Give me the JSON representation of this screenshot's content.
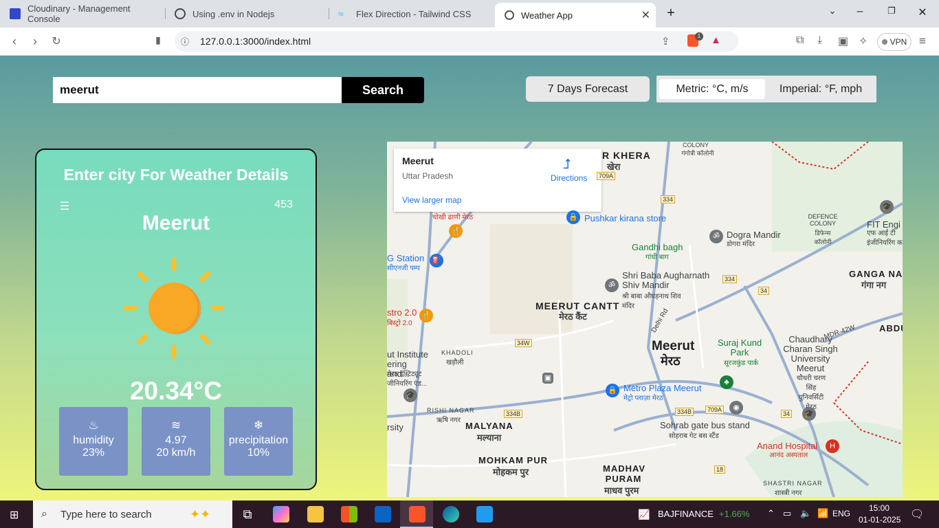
{
  "browser": {
    "tabs": [
      {
        "title": "Cloudinary - Management Console",
        "active": false
      },
      {
        "title": "Using .env in Nodejs",
        "active": false
      },
      {
        "title": "Flex Direction - Tailwind CSS",
        "active": false
      },
      {
        "title": "Weather App",
        "active": true
      }
    ],
    "url": "127.0.0.1:3000/index.html",
    "vpn_label": "VPN",
    "brave_badge": "1"
  },
  "app": {
    "search": {
      "value": "meerut",
      "button": "Search"
    },
    "forecast_button": "7 Days Forecast",
    "units": {
      "metric": "Metric: °C, m/s",
      "imperial": "Imperial: °F, mph",
      "selected": "metric"
    },
    "card": {
      "title": "Enter city For Weather Details",
      "code": "453",
      "city": "Meerut",
      "temperature": "20.34°C",
      "condition_icon": "sun-icon",
      "stats": [
        {
          "icon": "humidity-icon",
          "label": "humidity",
          "value": "23%"
        },
        {
          "icon": "wind-icon",
          "label": "4.97",
          "value": "20 km/h"
        },
        {
          "icon": "snowflake-icon",
          "label": "precipitation",
          "value": "10%"
        }
      ]
    }
  },
  "map": {
    "place": "Meerut",
    "region": "Uttar Pradesh",
    "directions": "Directions",
    "larger_map": "View larger map",
    "labels": {
      "khera": "R KHERA",
      "khera_hi": "खेरा",
      "colony": "COLONY",
      "colony_hi": "गंगोत्री कॉलोनी",
      "chokhi": "चोखी ढाणी मेरठ",
      "pushkar": "Pushkar kirana store",
      "dogra": "Dogra Mandir",
      "dogra_hi": "डोगरा मंदिर",
      "defence": "DEFENCE COLONY",
      "defence_hi": "डिफेन्स कॉलोनी",
      "fit": "FIT Engi",
      "fit_hi": "एफ आई टी इंजीनियरिंग क",
      "gandhi": "Gandhi bagh",
      "gandhi_hi": "गांधी बाग",
      "station": "G Station",
      "station_hi": "सीएनजी पम्प",
      "shribaba": "Shri Baba Augharnath Shiv Mandir",
      "shribaba_hi": "श्री बाबा औघड़नाथ शिव मंदिर",
      "ganga": "GANGA NA",
      "ganga_hi": "गंगा नग",
      "cantt": "MEERUT CANTT",
      "cantt_hi": "मेरठ कैंट",
      "stro": "stro 2.0",
      "stro_hi": "बिस्ट्रो 2.0",
      "abdu": "ABDU",
      "meerut": "Meerut",
      "meerut_hi": "मेरठ",
      "suraj": "Suraj Kund Park",
      "suraj_hi": "सूरजकुंड पार्क",
      "chaudhary": "Chaudhary Charan Singh University Meerut",
      "chaudhary_hi": "चौधरी चरण सिंह युनिवर्सिटी मेरठ",
      "khadoli": "KHADOLI",
      "khadoli_hi": "खड़ौली",
      "institute": "ut Institute ering and...",
      "institute_hi": "मेरठ इंस्टिट्यूट जीनियरिंग एंड...",
      "metro": "Metro Plaza Meerut",
      "metro_hi": "मेट्रो प्लाज़ा मेरठ",
      "rishi": "RISHI NAGAR",
      "rishi_hi": "ऋषि नगर",
      "malyana": "MALYANA",
      "malyana_hi": "मल्याना",
      "sohrab": "Sohrab gate bus stand",
      "sohrab_hi": "सोहराब गेट बस स्टैंड",
      "anand": "Anand Hospital",
      "anand_hi": "आनंद अस्पताल",
      "mohkam": "MOHKAM PUR",
      "mohkam_hi": "मोहकम पुर",
      "madhav": "MADHAV PURAM",
      "madhav_hi": "माधव पुरम",
      "shastri": "SHASTRI NAGAR",
      "shastri_hi": "शास्त्री नगर",
      "mdr": "MDR-42W",
      "delhi_rd": "Delhi Rd",
      "rsity": "rsity"
    },
    "shields": [
      "709A",
      "334",
      "34",
      "34W",
      "334B",
      "334B",
      "709A",
      "34",
      "18"
    ]
  },
  "taskbar": {
    "search_placeholder": "Type here to search",
    "stock_name": "BAJFINANCE",
    "stock_change": "+1.66%",
    "language": "ENG",
    "time": "15:00",
    "date": "01-01-2025"
  },
  "colors": {
    "accent_black": "#000000",
    "stat_tile": "#7b92c6",
    "sun": "#f9a825",
    "stock_up": "#4caf50"
  }
}
